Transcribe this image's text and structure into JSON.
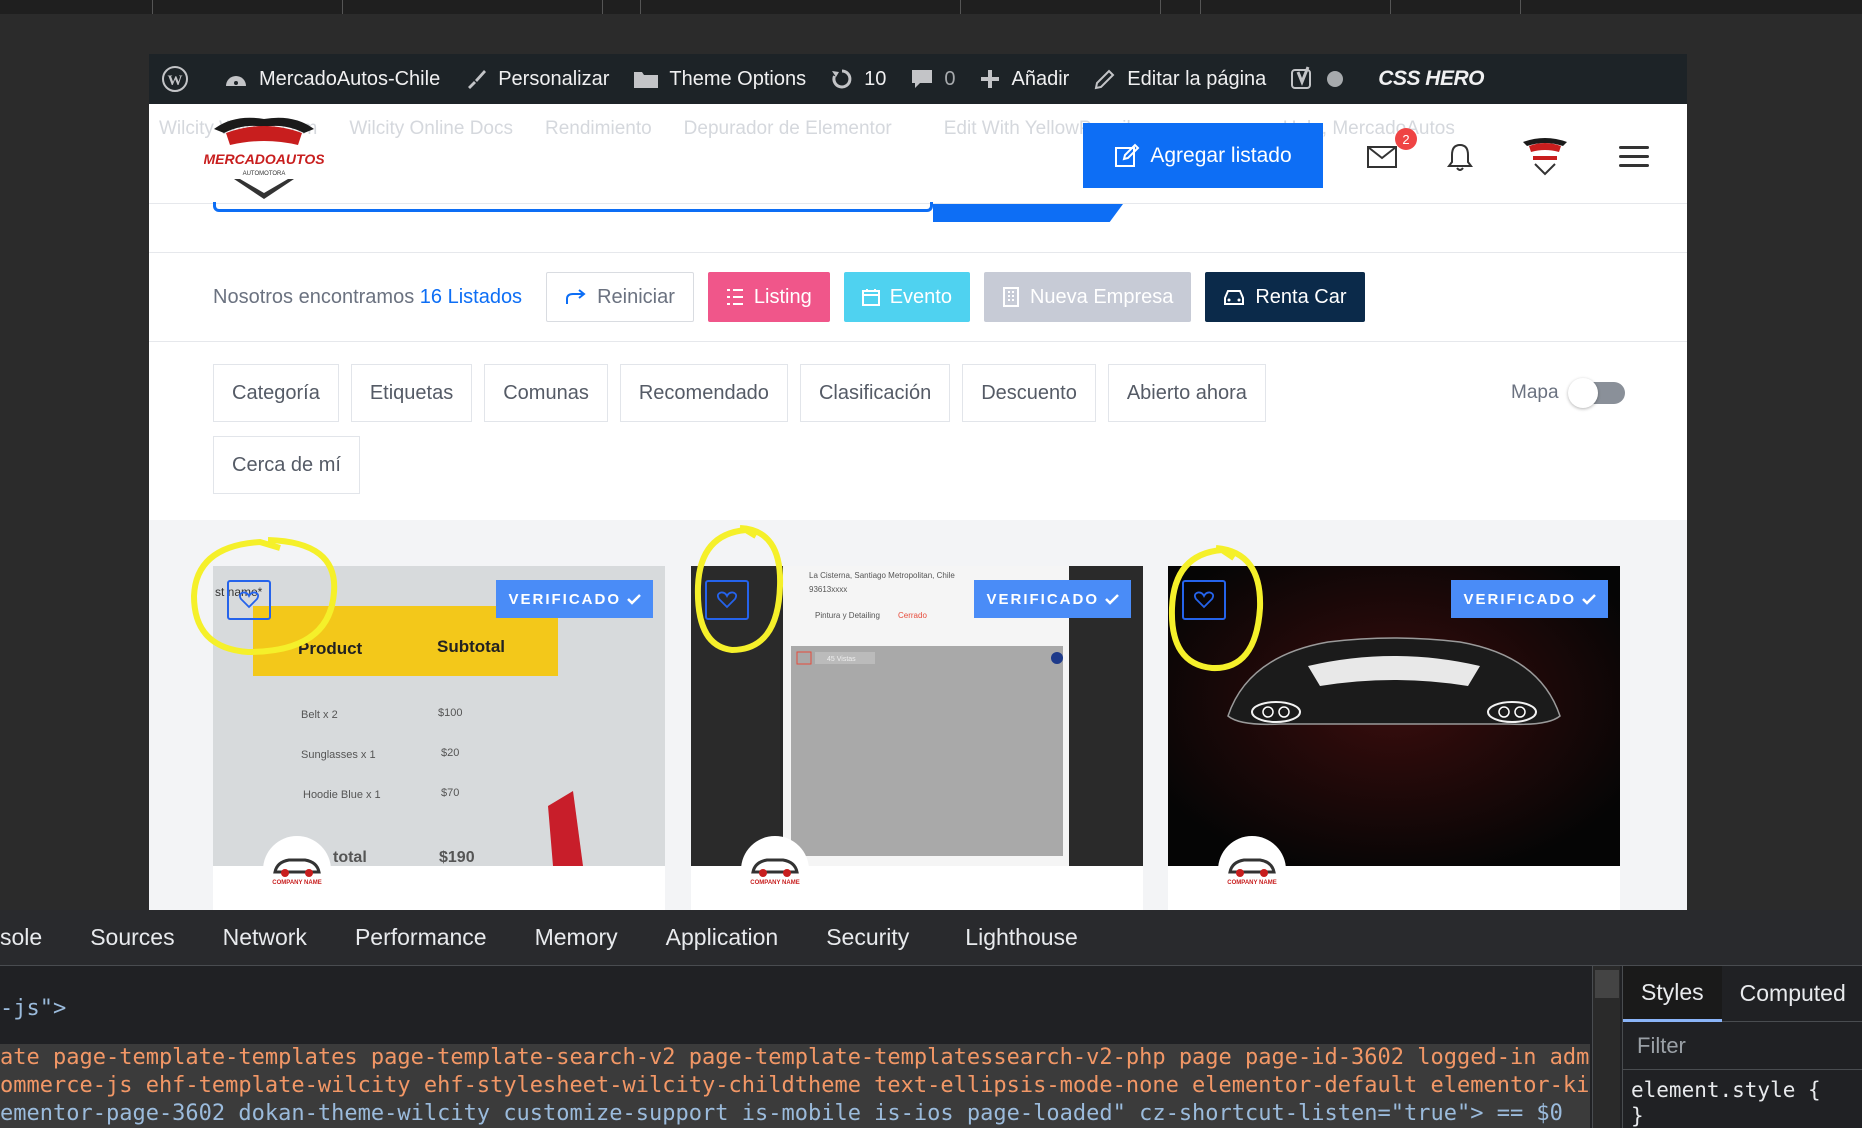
{
  "adminbar": {
    "site_name": "MercadoAutos-Chile",
    "customize": "Personalizar",
    "theme_options": "Theme Options",
    "updates_count": "10",
    "comments_count": "0",
    "add_new": "Añadir",
    "edit_page": "Editar la página",
    "css_hero": "CSS HERO"
  },
  "header": {
    "ghost_menu": [
      "Wilcity Wiloke.com",
      "Wilcity Online Docs",
      "Rendimiento",
      "Depurador de Elementor",
      "Edit With YellowPencil",
      "Hola, MercadoAutos"
    ],
    "logo_text": "MERCADOAUTOS",
    "logo_sub": "AUTOMOTORA",
    "add_listing": "Agregar listado",
    "message_badge": "2"
  },
  "results": {
    "found_prefix": "Nosotros encontramos",
    "found_count": "16 Listados",
    "reset": "Reiniciar",
    "types": [
      "Listing",
      "Evento",
      "Nueva Empresa",
      "Renta Car"
    ]
  },
  "filters": {
    "chips_row1": [
      "Categoría",
      "Etiquetas",
      "Comunas",
      "Recomendado",
      "Clasificación",
      "Descuento",
      "Abierto ahora"
    ],
    "chips_row2": [
      "Cerca de mí"
    ],
    "map_label": "Mapa"
  },
  "cards": [
    {
      "verified": "VERIFICADO",
      "company": "COMPANY NAME",
      "receipt": {
        "name_field": "st name*",
        "col_product": "Product",
        "col_subtotal": "Subtotal",
        "rows": [
          [
            "Belt x 2",
            "$100"
          ],
          [
            "Sunglasses x 1",
            "$20"
          ],
          [
            "Hoodie Blue x 1",
            "$70"
          ]
        ],
        "total_label": "total",
        "total_value": "$190"
      }
    },
    {
      "verified": "VERIFICADO",
      "company": "COMPANY NAME",
      "screenshot": {
        "location": "La Cisterna, Santiago Metropolitan, Chile",
        "phone": "93613xxxx",
        "category": "Pintura y Detailing",
        "status": "Cerrado",
        "views": "45 Vistas"
      }
    },
    {
      "verified": "VERIFICADO",
      "company": "COMPANY NAME"
    }
  ],
  "devtools": {
    "tabs": [
      "sole",
      "Sources",
      "Network",
      "Performance",
      "Memory",
      "Application",
      "Security",
      "Lighthouse"
    ],
    "code_line1": "-js\">",
    "code_line2": "ate page-template-templates page-template-search-v2 page-template-templatessearch-v2-php page page-id-3602 logged-in adm",
    "code_line3": "ommerce-js ehf-template-wilcity ehf-stylesheet-wilcity-childtheme text-ellipsis-mode-none elementor-default elementor-ki",
    "code_line4": "ementor-page-3602 dokan-theme-wilcity customize-support is-mobile is-ios page-loaded\" cz-shortcut-listen=\"true\"> == $0",
    "side_tabs": [
      "Styles",
      "Computed"
    ],
    "filter_placeholder": "Filter",
    "style_rule": "element.style {",
    "style_close": "}"
  },
  "colors": {
    "primary": "#0d6ef5",
    "listing": "#f0568a",
    "event": "#4fd2f0",
    "company": "#c7cbd6",
    "rent": "#0b2a4a",
    "verified": "#4a8cf7",
    "annotation": "#f5f02a"
  }
}
